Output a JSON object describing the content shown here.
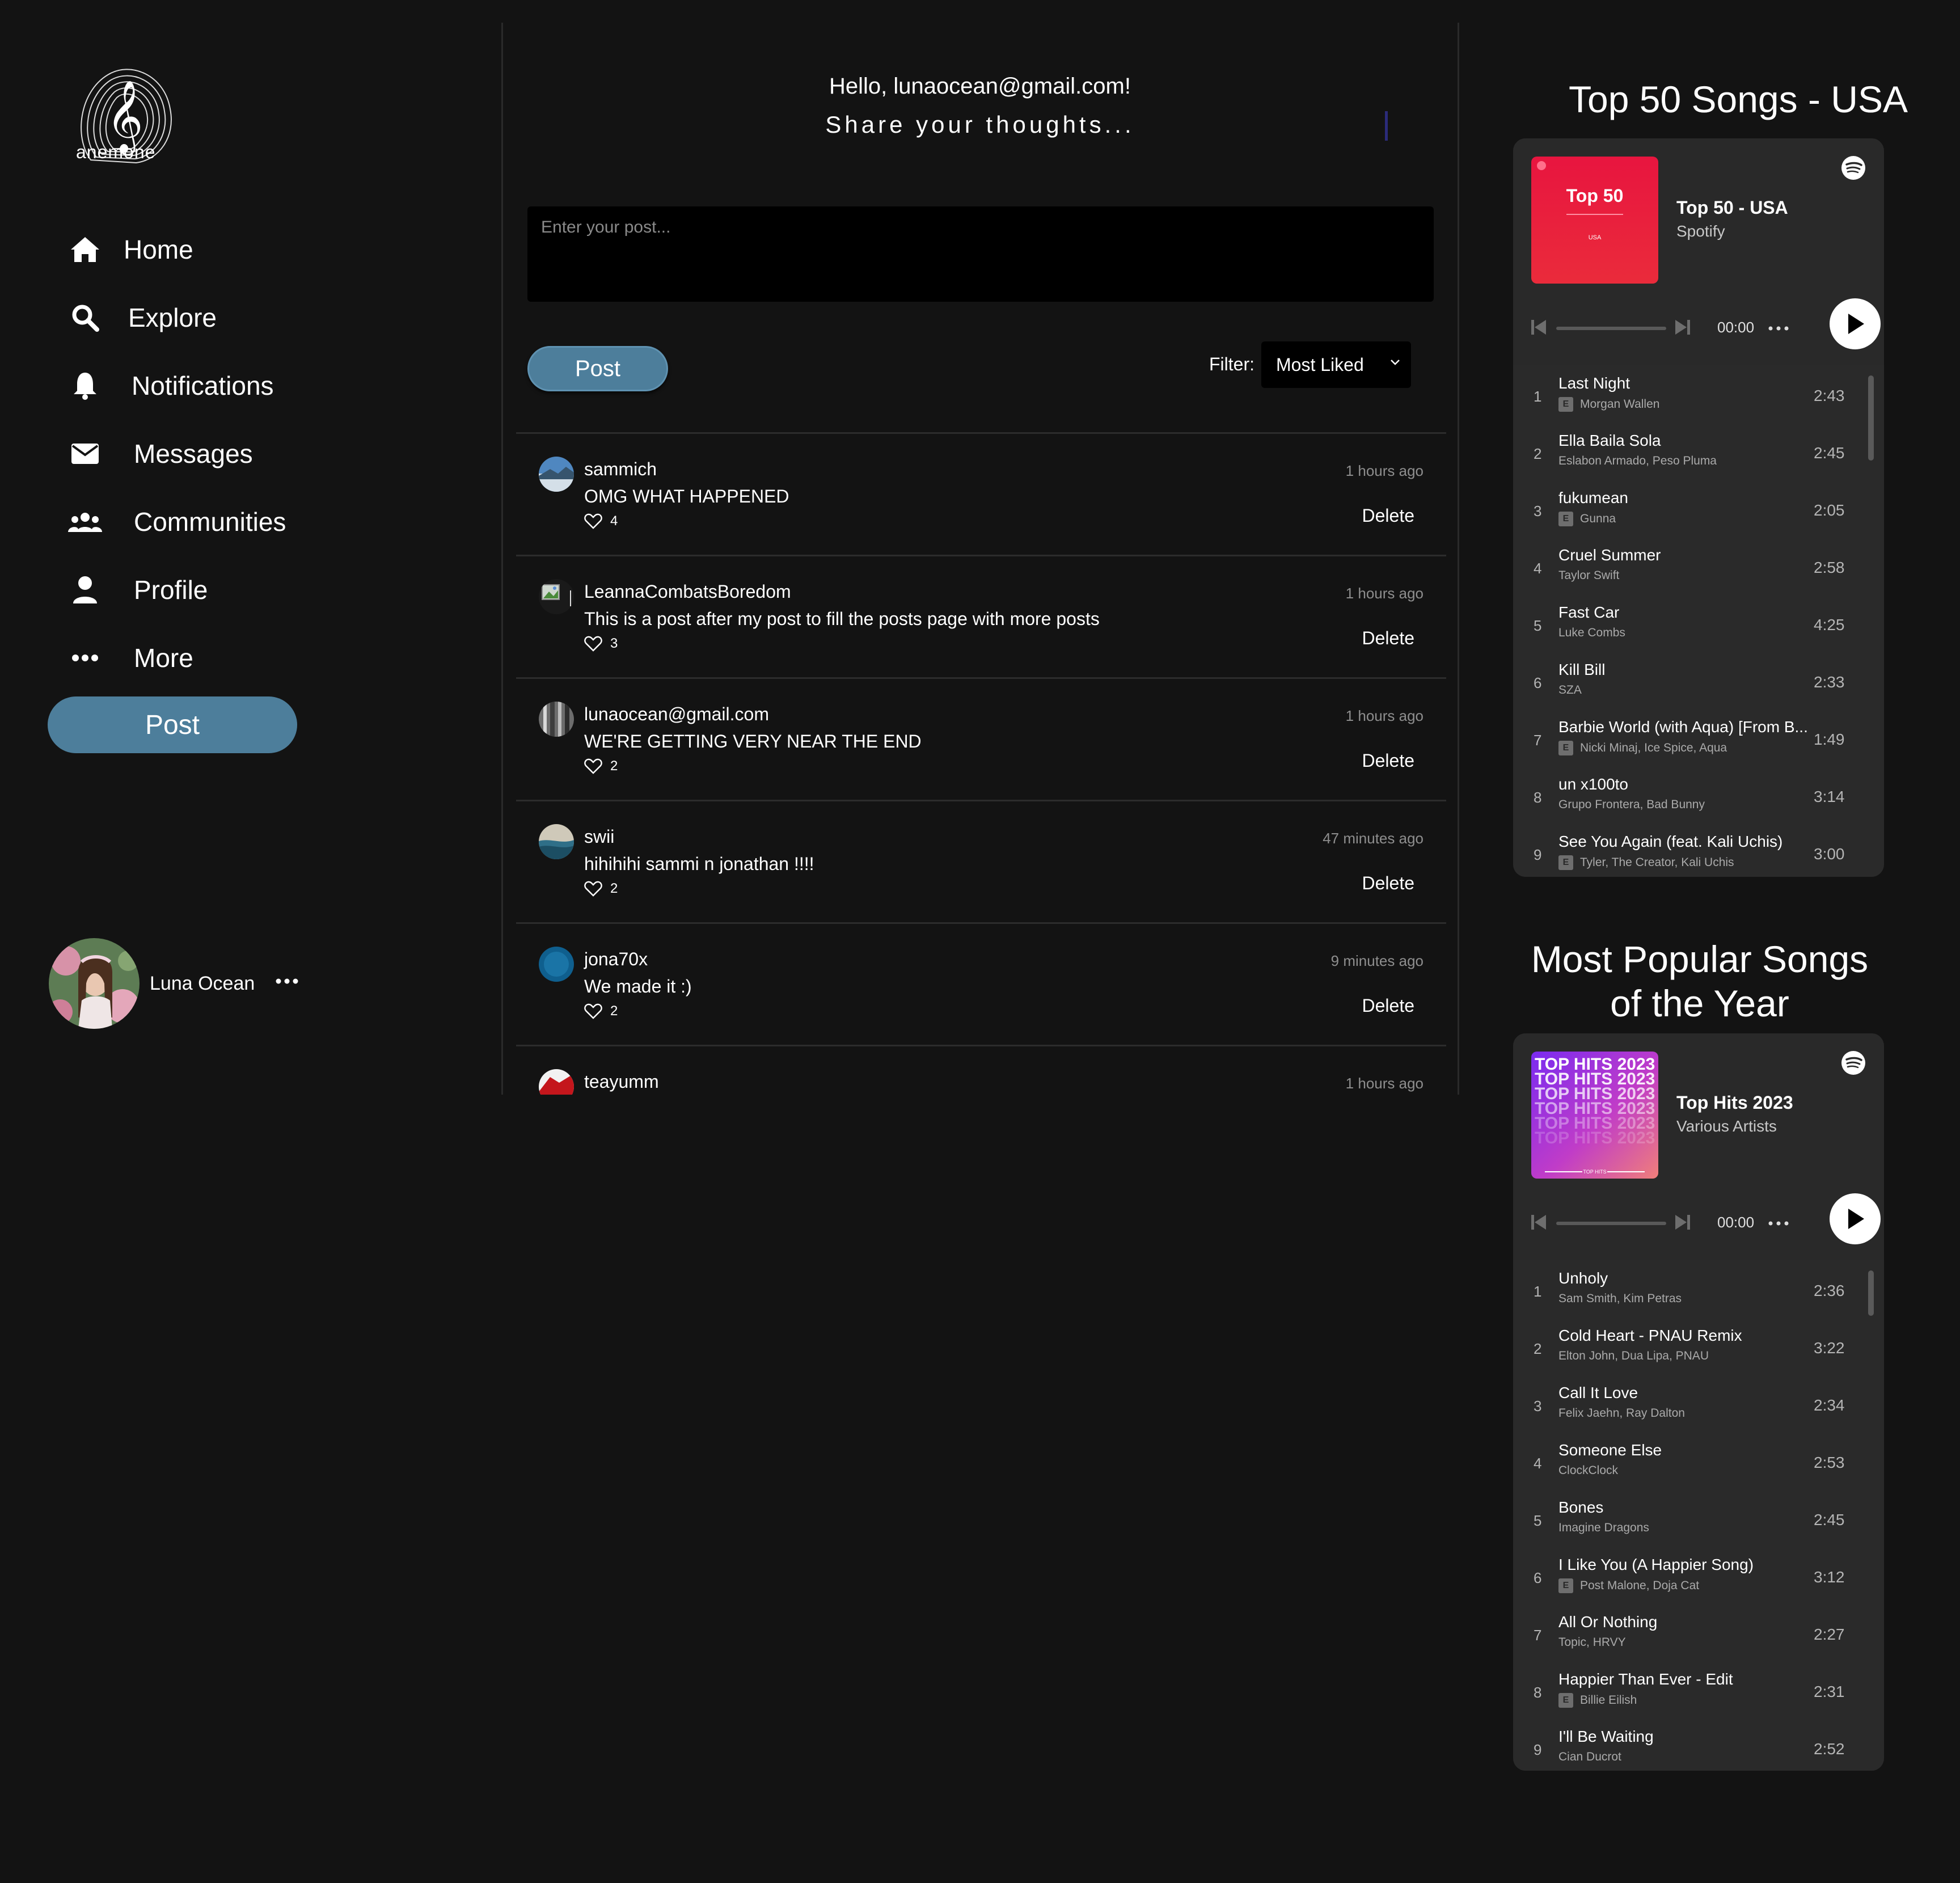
{
  "brand": {
    "name": "anemone"
  },
  "nav": {
    "items": [
      {
        "label": "Home",
        "icon": "home-icon"
      },
      {
        "label": "Explore",
        "icon": "search-icon"
      },
      {
        "label": "Notifications",
        "icon": "bell-icon"
      },
      {
        "label": "Messages",
        "icon": "envelope-icon"
      },
      {
        "label": "Communities",
        "icon": "users-icon"
      },
      {
        "label": "Profile",
        "icon": "user-icon"
      },
      {
        "label": "More",
        "icon": "more-icon"
      }
    ],
    "post_button": "Post"
  },
  "user": {
    "name": "Luna Ocean"
  },
  "feed": {
    "greeting": "Hello, lunaocean@gmail.com!",
    "tagline": "Share your thoughts...",
    "input_placeholder": "Enter your post...",
    "post_button": "Post",
    "filter_label": "Filter:",
    "filter_value": "Most Liked",
    "delete_label": "Delete",
    "posts": [
      {
        "author": "sammich",
        "time": "1 hours ago",
        "content": "OMG WHAT HAPPENED",
        "likes": "4"
      },
      {
        "author": "LeannaCombatsBoredom",
        "time": "1 hours ago",
        "content": "This is a post after my post to fill the posts page with more posts",
        "likes": "3"
      },
      {
        "author": "lunaocean@gmail.com",
        "time": "1 hours ago",
        "content": "WE'RE GETTING VERY NEAR THE END",
        "likes": "2"
      },
      {
        "author": "swii",
        "time": "47 minutes ago",
        "content": "hihihihi sammi n jonathan !!!!",
        "likes": "2"
      },
      {
        "author": "jona70x",
        "time": "9 minutes ago",
        "content": "We made it :)",
        "likes": "2"
      },
      {
        "author": "teayumm",
        "time": "1 hours ago",
        "content": "",
        "likes": ""
      }
    ]
  },
  "widgets": [
    {
      "title": "Top 50 Songs - USA",
      "playlist_name": "Top 50 - USA",
      "playlist_owner": "Spotify",
      "cover_title": "Top 50",
      "cover_sub": "USA",
      "time": "00:00",
      "tracks": [
        {
          "num": "1",
          "name": "Last Night",
          "artist": "Morgan Wallen",
          "explicit": true,
          "duration": "2:43"
        },
        {
          "num": "2",
          "name": "Ella Baila Sola",
          "artist": "Eslabon Armado, Peso Pluma",
          "explicit": false,
          "duration": "2:45"
        },
        {
          "num": "3",
          "name": "fukumean",
          "artist": "Gunna",
          "explicit": true,
          "duration": "2:05"
        },
        {
          "num": "4",
          "name": "Cruel Summer",
          "artist": "Taylor Swift",
          "explicit": false,
          "duration": "2:58"
        },
        {
          "num": "5",
          "name": "Fast Car",
          "artist": "Luke Combs",
          "explicit": false,
          "duration": "4:25"
        },
        {
          "num": "6",
          "name": "Kill Bill",
          "artist": "SZA",
          "explicit": false,
          "duration": "2:33"
        },
        {
          "num": "7",
          "name": "Barbie World (with Aqua) [From B...",
          "artist": "Nicki Minaj, Ice Spice, Aqua",
          "explicit": true,
          "duration": "1:49"
        },
        {
          "num": "8",
          "name": "un x100to",
          "artist": "Grupo Frontera, Bad Bunny",
          "explicit": false,
          "duration": "3:14"
        },
        {
          "num": "9",
          "name": "See You Again (feat. Kali Uchis)",
          "artist": "Tyler, The Creator, Kali Uchis",
          "explicit": true,
          "duration": "3:00"
        }
      ]
    },
    {
      "title": "Most Popular Songs of the Year",
      "playlist_name": "Top Hits 2023",
      "playlist_owner": "Various Artists",
      "cover_title": "TOP HITS 2023",
      "cover_sub": "TOP HITS",
      "time": "00:00",
      "tracks": [
        {
          "num": "1",
          "name": "Unholy",
          "artist": "Sam Smith, Kim Petras",
          "explicit": false,
          "duration": "2:36"
        },
        {
          "num": "2",
          "name": "Cold Heart - PNAU Remix",
          "artist": "Elton John, Dua Lipa, PNAU",
          "explicit": false,
          "duration": "3:22"
        },
        {
          "num": "3",
          "name": "Call It Love",
          "artist": "Felix Jaehn, Ray Dalton",
          "explicit": false,
          "duration": "2:34"
        },
        {
          "num": "4",
          "name": "Someone Else",
          "artist": "ClockClock",
          "explicit": false,
          "duration": "2:53"
        },
        {
          "num": "5",
          "name": "Bones",
          "artist": "Imagine Dragons",
          "explicit": false,
          "duration": "2:45"
        },
        {
          "num": "6",
          "name": "I Like You (A Happier Song)",
          "artist": "Post Malone, Doja Cat",
          "explicit": true,
          "duration": "3:12"
        },
        {
          "num": "7",
          "name": "All Or Nothing",
          "artist": "Topic, HRVY",
          "explicit": false,
          "duration": "2:27"
        },
        {
          "num": "8",
          "name": "Happier Than Ever - Edit",
          "artist": "Billie Eilish",
          "explicit": true,
          "duration": "2:31"
        },
        {
          "num": "9",
          "name": "I'll Be Waiting",
          "artist": "Cian Ducrot",
          "explicit": false,
          "duration": "2:52"
        }
      ]
    }
  ],
  "colors": {
    "background": "#131313",
    "accent": "#4d7e9b",
    "panel": "#282828",
    "cover_red": "#e8163f",
    "cover_purple": "#8a2be2"
  }
}
